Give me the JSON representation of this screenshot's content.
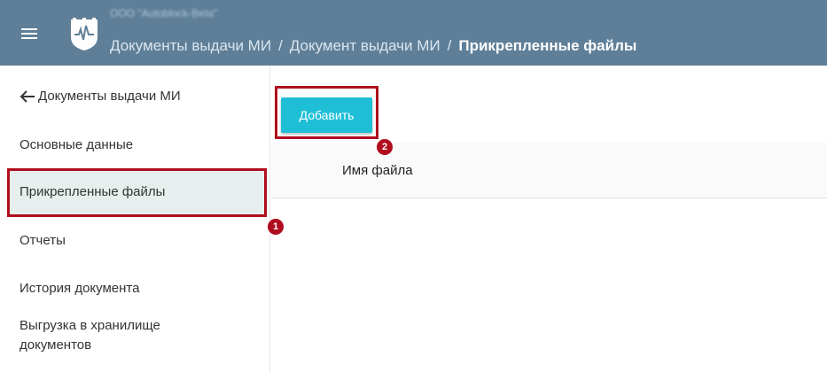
{
  "header": {
    "org_name": "ООО \"Autoblock-Beta\"",
    "breadcrumb": {
      "item1": "Документы выдачи МИ",
      "item2": "Документ выдачи МИ",
      "current": "Прикрепленные файлы",
      "separator": "/"
    },
    "menu_icon": "hamburger-icon",
    "logo_icon": "crest-logo-icon"
  },
  "sidebar": {
    "back_label": "Документы выдачи МИ",
    "items": [
      {
        "label": "Основные данные"
      },
      {
        "label": "Прикрепленные файлы",
        "active": true
      },
      {
        "label": "Отчеты"
      },
      {
        "label": "История документа"
      },
      {
        "label": "Выгрузка в хранилище документов"
      }
    ]
  },
  "toolbar": {
    "add_label": "Добавить"
  },
  "table": {
    "columns": [
      "Имя файла"
    ]
  },
  "annotations": {
    "badge1": "1",
    "badge2": "2"
  },
  "colors": {
    "header_bg": "#5f7f98",
    "accent_button": "#1ebfd6",
    "highlight_red": "#b00d1e",
    "active_item_bg": "#e6efed"
  }
}
